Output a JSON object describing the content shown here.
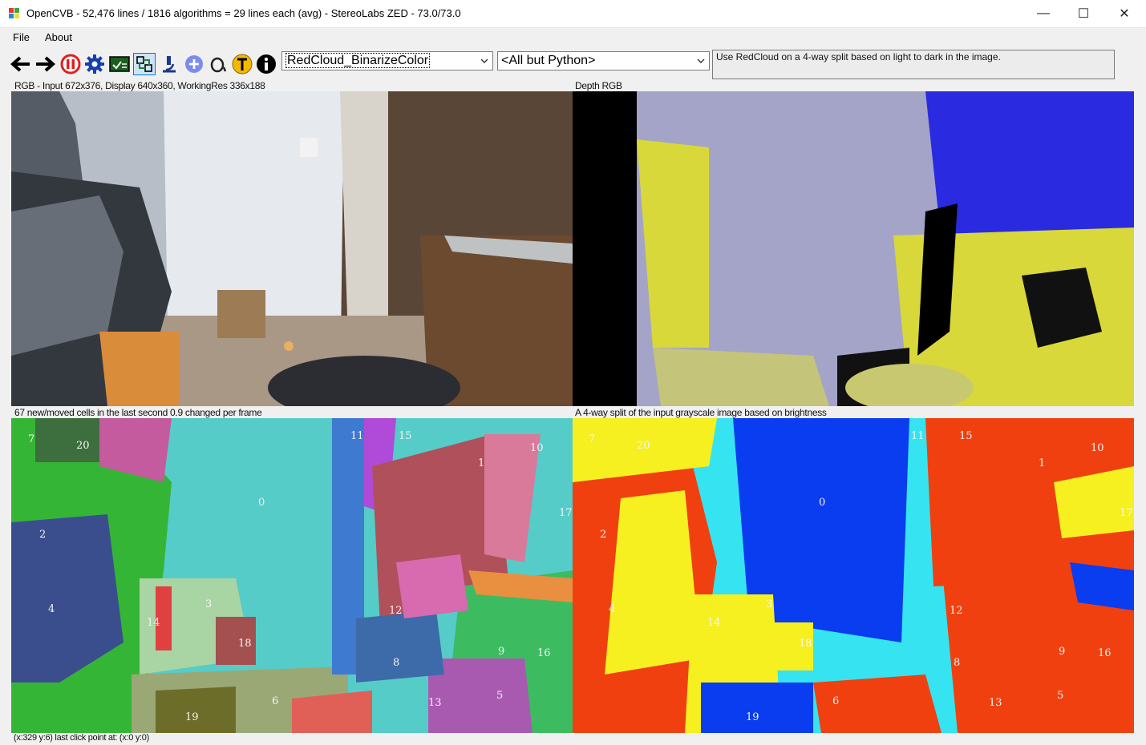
{
  "window": {
    "title": "OpenCVB - 52,476 lines / 1816 algorithms = 29 lines each (avg) - StereoLabs ZED - 73.0/73.0",
    "minimize_glyph": "—",
    "maximize_glyph": "☐",
    "close_glyph": "✕"
  },
  "menu": {
    "file": "File",
    "about": "About"
  },
  "toolbar": {
    "icons": [
      "back-arrow-icon",
      "forward-arrow-icon",
      "pause-icon",
      "gear-icon",
      "test-all-icon",
      "snapshot-icon",
      "microscope-icon",
      "plus-circle-icon",
      "zoom-icon",
      "translate-T-icon",
      "info-icon"
    ],
    "algorithm_select": "RedCloud_BinarizeColor",
    "group_select": "<All but Python>",
    "description": "Use RedCloud on a 4-way split based on light to dark in the image."
  },
  "panels": {
    "top_left_caption": "RGB - Input 672x376, Display 640x360, WorkingRes 336x188",
    "top_right_caption": "Depth RGB",
    "bottom_left_caption": "67 new/moved cells in the last second 0.9 changed per frame",
    "bottom_right_caption": "A 4-way split of the input grayscale image based on brightness"
  },
  "cell_labels": [
    "7",
    "20",
    "2",
    "4",
    "14",
    "3",
    "18",
    "19",
    "6",
    "0",
    "11",
    "15",
    "1",
    "10",
    "17",
    "12",
    "8",
    "9",
    "16",
    "13",
    "5"
  ],
  "status": "(x:329 y:6) last click point at: (x:0 y:0)",
  "colors": {
    "accent_selected": "#0078d7",
    "depth_yellow": "#d8d83a",
    "depth_gray": "#a4a4c8",
    "depth_blue": "#2a2ae0",
    "split_blue": "#0a3cf0",
    "split_cyan": "#35e4f0",
    "split_yellow": "#f6f020",
    "split_red": "#f04010"
  }
}
